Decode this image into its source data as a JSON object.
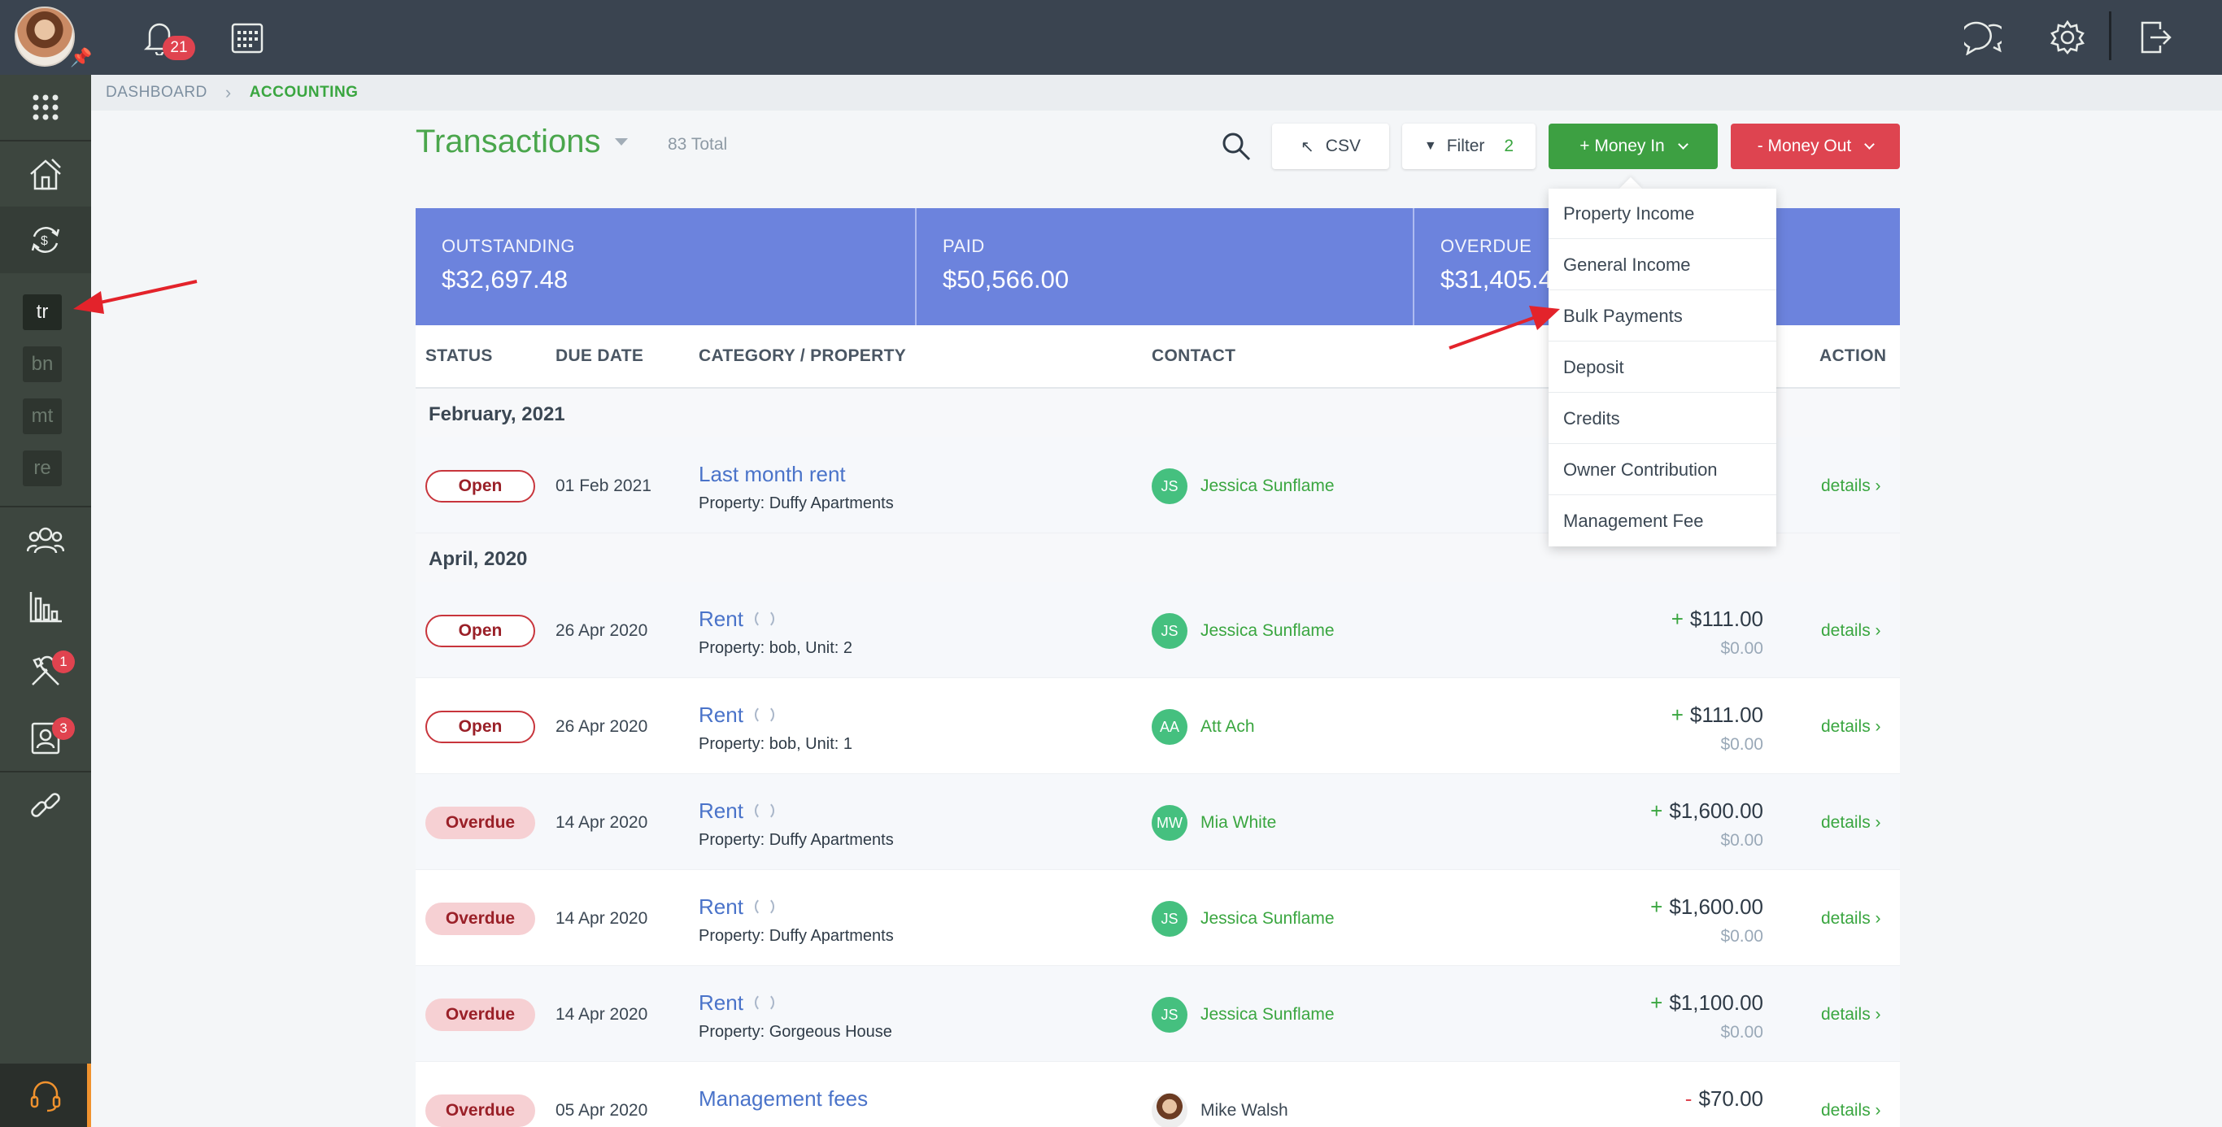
{
  "header": {
    "notifications_count": "21"
  },
  "sidebar": {
    "sub_items": [
      "tr",
      "bn",
      "mt",
      "re"
    ],
    "tools_badge": "1",
    "contacts_badge": "3"
  },
  "breadcrumb": {
    "dashboard": "DASHBOARD",
    "accounting": "ACCOUNTING"
  },
  "page": {
    "title": "Transactions",
    "total": "83 Total"
  },
  "toolbar": {
    "csv_label": "CSV",
    "filter_label": "Filter",
    "filter_count": "2",
    "money_in_label": "+ Money In",
    "money_out_label": "- Money Out"
  },
  "summary": {
    "outstanding_label": "OUTSTANDING",
    "outstanding_value": "$32,697.48",
    "paid_label": "PAID",
    "paid_value": "$50,566.00",
    "overdue_label": "OVERDUE",
    "overdue_value": "$31,405.4"
  },
  "table": {
    "headers": {
      "status": "STATUS",
      "due_date": "DUE DATE",
      "category": "CATEGORY / PROPERTY",
      "contact": "CONTACT",
      "action": "ACTION"
    },
    "groups": [
      "February, 2021",
      "April, 2020"
    ],
    "rows": [
      {
        "status": "Open",
        "due": "01 Feb 2021",
        "category": "Last month rent",
        "property": "Property: Duffy Apartments",
        "initials": "JS",
        "contact": "Jessica Sunflame",
        "sign": "",
        "amount": "",
        "paid": "",
        "action": "details ›"
      },
      {
        "status": "Open",
        "due": "26 Apr 2020",
        "category": "Rent",
        "property": "Property: bob, Unit: 2",
        "initials": "JS",
        "contact": "Jessica Sunflame",
        "sign": "+",
        "amount": "$111.00",
        "paid": "$0.00",
        "action": "details ›"
      },
      {
        "status": "Open",
        "due": "26 Apr 2020",
        "category": "Rent",
        "property": "Property: bob, Unit: 1",
        "initials": "AA",
        "contact": "Att Ach",
        "sign": "+",
        "amount": "$111.00",
        "paid": "$0.00",
        "action": "details ›"
      },
      {
        "status": "Overdue",
        "due": "14 Apr 2020",
        "category": "Rent",
        "property": "Property: Duffy Apartments",
        "initials": "MW",
        "contact": "Mia White",
        "sign": "+",
        "amount": "$1,600.00",
        "paid": "$0.00",
        "action": "details ›"
      },
      {
        "status": "Overdue",
        "due": "14 Apr 2020",
        "category": "Rent",
        "property": "Property: Duffy Apartments",
        "initials": "JS",
        "contact": "Jessica Sunflame",
        "sign": "+",
        "amount": "$1,600.00",
        "paid": "$0.00",
        "action": "details ›"
      },
      {
        "status": "Overdue",
        "due": "14 Apr 2020",
        "category": "Rent",
        "property": "Property: Gorgeous House",
        "initials": "JS",
        "contact": "Jessica Sunflame",
        "sign": "+",
        "amount": "$1,100.00",
        "paid": "$0.00",
        "action": "details ›"
      },
      {
        "status": "Overdue",
        "due": "05 Apr 2020",
        "category": "Management fees",
        "property": "",
        "initials": "",
        "contact": "Mike Walsh",
        "sign": "-",
        "amount": "$70.00",
        "paid": "",
        "action": "details ›"
      }
    ]
  },
  "money_in_menu": {
    "items": [
      "Property Income",
      "General Income",
      "Bulk Payments",
      "Deposit",
      "Credits",
      "Owner Contribution",
      "Management Fee"
    ]
  },
  "colors": {
    "accent_green": "#3da042",
    "danger_red": "#de4450",
    "summary_blue": "#6c83dd",
    "annotation_arrow": "#e3232b"
  }
}
